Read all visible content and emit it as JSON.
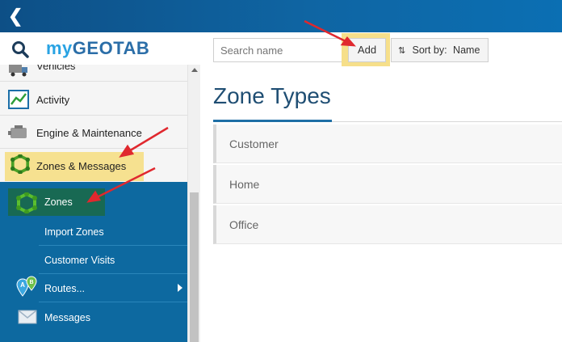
{
  "topbar": {
    "back_glyph": "❮"
  },
  "brand": {
    "logo_my": "my",
    "logo_geo": "GEOTAB"
  },
  "nav": {
    "items": [
      {
        "label": "Vehicles",
        "icon": "truck-icon"
      },
      {
        "label": "Activity",
        "icon": "activity-chart-icon"
      },
      {
        "label": "Engine & Maintenance",
        "icon": "engine-icon"
      },
      {
        "label": "Zones & Messages",
        "icon": "zone-polygon-icon"
      }
    ],
    "subitems": [
      {
        "label": "Zones",
        "icon": "zone-polygon-icon"
      },
      {
        "label": "Import Zones"
      },
      {
        "label": "Customer Visits"
      },
      {
        "label": "Routes...",
        "icon": "route-pins-icon"
      },
      {
        "label": "Messages",
        "icon": "envelope-icon"
      }
    ]
  },
  "toolbar": {
    "search_placeholder": "Search name",
    "add_label": "Add",
    "sort_prefix": "Sort by:",
    "sort_value": "Name"
  },
  "main": {
    "title": "Zone Types",
    "rows": [
      "Customer",
      "Home",
      "Office"
    ]
  },
  "colors": {
    "topbar": "#0f65a3",
    "highlight": "#f6df8a",
    "submenu": "#0d69a0",
    "arrow": "#e0282e"
  }
}
